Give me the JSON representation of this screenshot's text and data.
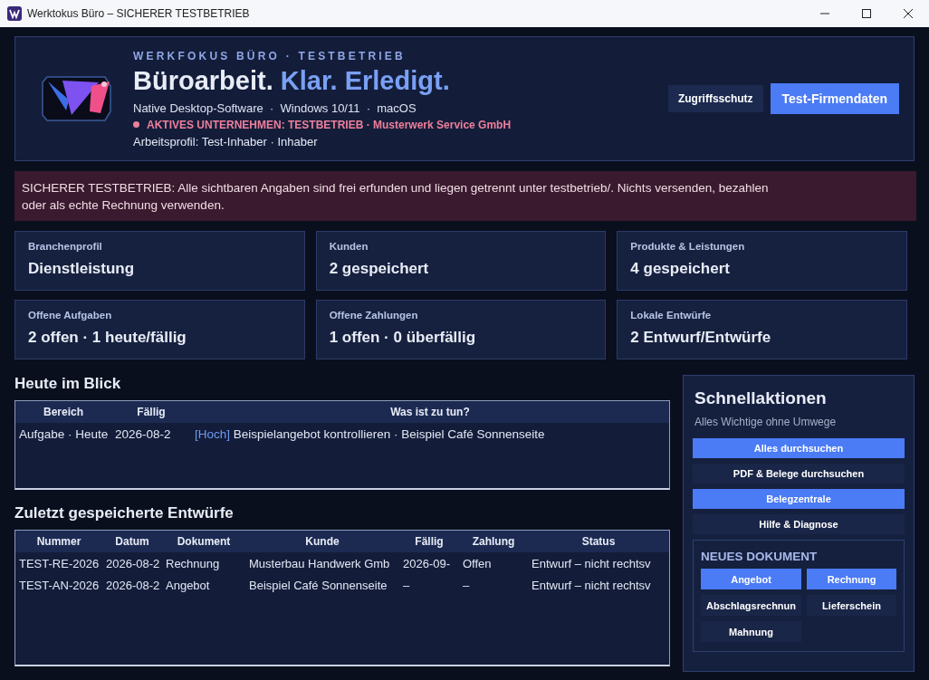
{
  "window": {
    "title": "Werktokus Büro – SICHERER TESTBETRIEB"
  },
  "header": {
    "eyebrow": "WERKFOKUS BÜRO · TESTBETRIEB",
    "headline_main": "Büroarbeit.",
    "headline_accent": "Klar. Erledigt.",
    "platforms": "Native Desktop-Software  ·  Windows 10/11  ·  macOS",
    "active_company": "AKTIVES UNTERNEHMEN: TESTBETRIEB · Musterwerk Service GmbH",
    "profile": "Arbeitsprofil: Test-Inhaber · Inhaber",
    "buttons": [
      {
        "label": "Zugriffsschutz",
        "primary": false
      },
      {
        "label": "Test-Firmendaten",
        "primary": true
      }
    ]
  },
  "notice": "SICHERER TESTBETRIEB: Alle sichtbaren Angaben sind frei erfunden und liegen getrennt unter testbetrieb/. Nichts versenden, bezahlen oder als echte Rechnung verwenden.",
  "stats": [
    {
      "label": "Branchenprofil",
      "value": "Dienstleistung"
    },
    {
      "label": "Kunden",
      "value": "2 gespeichert"
    },
    {
      "label": "Produkte & Leistungen",
      "value": "4 gespeichert"
    },
    {
      "label": "Offene Aufgaben",
      "value": "2 offen · 1 heute/fällig"
    },
    {
      "label": "Offene Zahlungen",
      "value": "1 offen · 0 überfällig"
    },
    {
      "label": "Lokale Entwürfe",
      "value": "2 Entwurf/Entwürfe"
    }
  ],
  "today": {
    "title": "Heute im Blick",
    "columns": [
      "Bereich",
      "Fällig",
      "Was ist zu tun?"
    ],
    "rows": [
      {
        "area": "Aufgabe · Heute",
        "due": "2026-08-2",
        "priority": "[Hoch]",
        "task": "Beispielangebot kontrollieren · Beispiel Café Sonnenseite"
      }
    ]
  },
  "drafts": {
    "title": "Zuletzt gespeicherte Entwürfe",
    "columns": [
      "Nummer",
      "Datum",
      "Dokument",
      "Kunde",
      "Fällig",
      "Zahlung",
      "Status"
    ],
    "rows": [
      [
        "TEST-RE-2026",
        "2026-08-2",
        "Rechnung",
        "Musterbau Handwerk Gmb",
        "2026-09-",
        "Offen",
        "Entwurf – nicht rechtsv"
      ],
      [
        "TEST-AN-2026",
        "2026-08-2",
        "Angebot",
        "Beispiel Café Sonnenseite",
        "–",
        "–",
        "Entwurf – nicht rechtsv"
      ]
    ]
  },
  "quick_actions": {
    "title": "Schnellaktionen",
    "subtitle": "Alles Wichtige ohne Umwege",
    "buttons": [
      {
        "label": "Alles durchsuchen",
        "primary": true
      },
      {
        "label": "PDF & Belege durchsuchen",
        "primary": false
      },
      {
        "label": "Belegzentrale",
        "primary": true
      },
      {
        "label": "Hilfe & Diagnose",
        "primary": false
      }
    ],
    "new_document": {
      "title": "NEUES DOKUMENT",
      "buttons": [
        {
          "label": "Angebot",
          "primary": true
        },
        {
          "label": "Rechnung",
          "primary": true
        },
        {
          "label": "Abschlagsrechnun",
          "primary": false
        },
        {
          "label": "Lieferschein",
          "primary": false
        },
        {
          "label": "Mahnung",
          "primary": false
        }
      ]
    }
  }
}
